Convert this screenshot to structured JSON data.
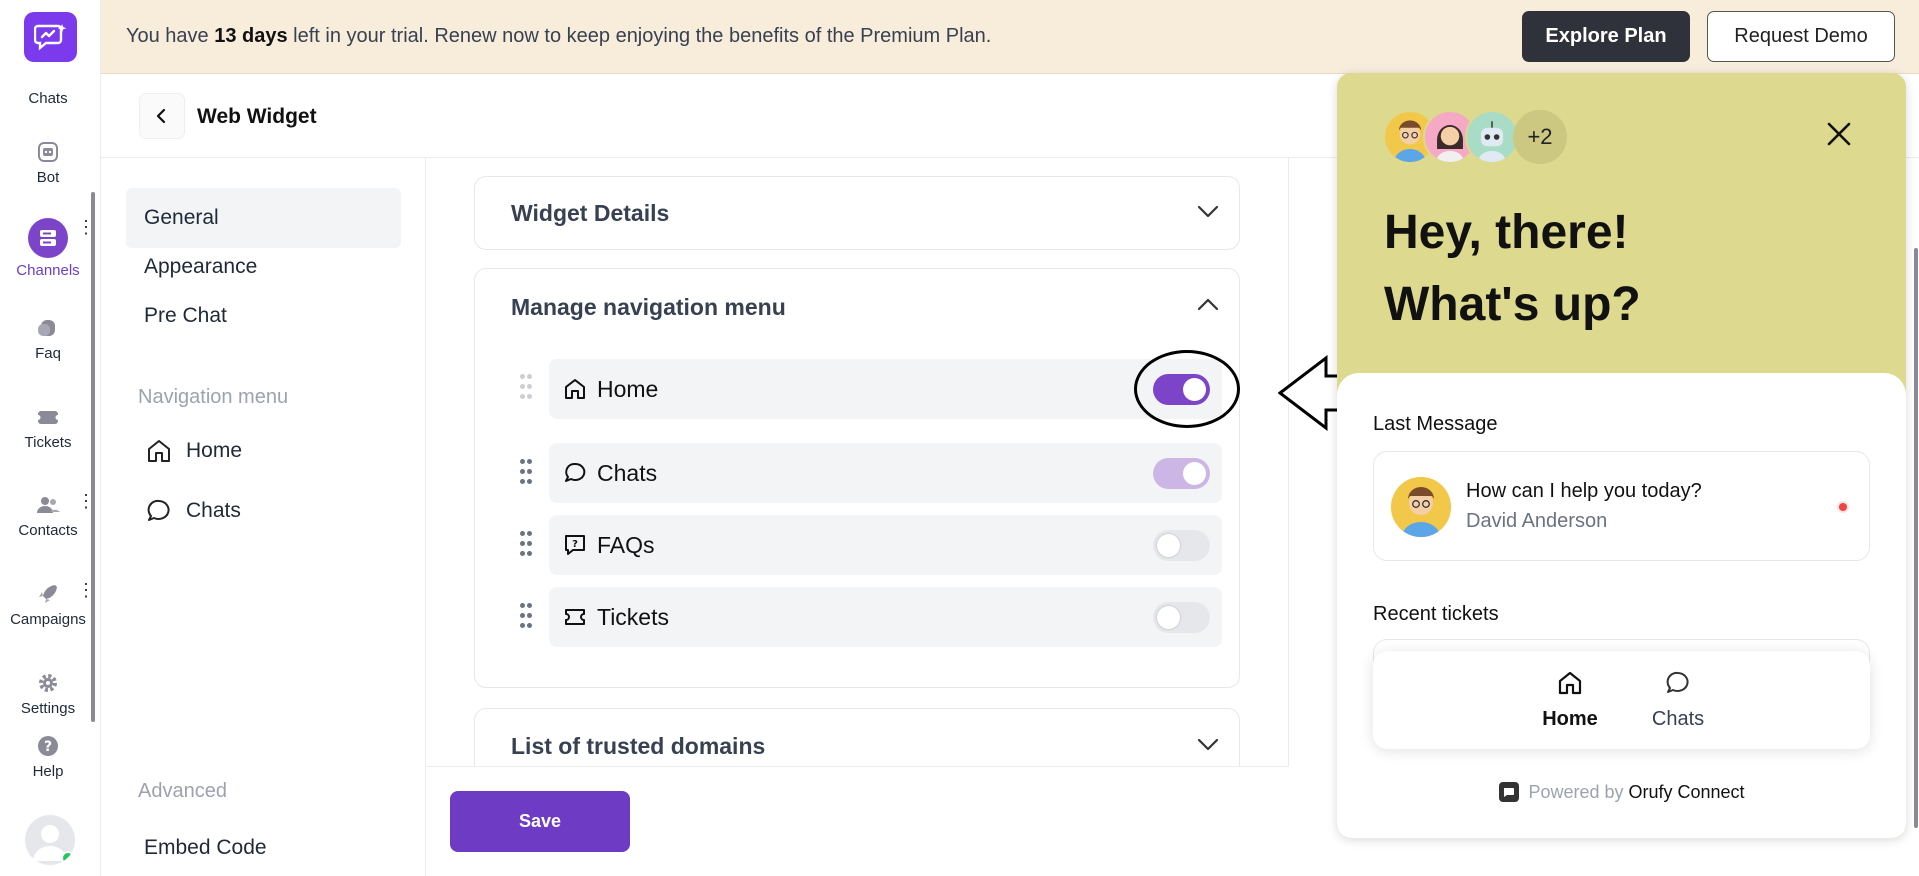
{
  "banner": {
    "text_before": "You have ",
    "days": "13 days",
    "text_after": " left in your trial. Renew now to keep enjoying the benefits of the Premium Plan.",
    "explore_label": "Explore Plan",
    "demo_label": "Request Demo"
  },
  "rail": {
    "items": [
      {
        "label": "Chats",
        "icon": "chat-sparkle-icon"
      },
      {
        "label": "Bot",
        "icon": "bot-icon"
      },
      {
        "label": "Channels",
        "icon": "channels-icon",
        "active": true
      },
      {
        "label": "Faq",
        "icon": "faq-icon"
      },
      {
        "label": "Tickets",
        "icon": "tickets-icon"
      },
      {
        "label": "Contacts",
        "icon": "contacts-icon"
      },
      {
        "label": "Campaigns",
        "icon": "rocket-icon"
      },
      {
        "label": "Settings",
        "icon": "gear-icon"
      },
      {
        "label": "Help",
        "icon": "help-icon"
      }
    ]
  },
  "header": {
    "title": "Web Widget"
  },
  "sidebar": {
    "general": "General",
    "appearance": "Appearance",
    "pre_chat": "Pre Chat",
    "nav_section": "Navigation menu",
    "nav_home": "Home",
    "nav_chats": "Chats",
    "advanced_section": "Advanced",
    "embed_code": "Embed Code"
  },
  "main": {
    "widget_details": "Widget Details",
    "manage_nav": "Manage navigation menu",
    "nav_rows": [
      {
        "label": "Home",
        "icon": "home-icon",
        "state": "on"
      },
      {
        "label": "Chats",
        "icon": "chat-bubble-icon",
        "state": "on-disabled"
      },
      {
        "label": "FAQs",
        "icon": "faq-box-icon",
        "state": "off"
      },
      {
        "label": "Tickets",
        "icon": "ticket-icon",
        "state": "off"
      }
    ],
    "trusted_domains": "List of trusted domains",
    "save_label": "Save"
  },
  "preview": {
    "more_count": "+2",
    "greeting_line1": "Hey, there!",
    "greeting_line2": "What's up?",
    "last_message_title": "Last Message",
    "message_text": "How can I help you today?",
    "message_author": "David Anderson",
    "recent_tickets_title": "Recent tickets",
    "tab_home": "Home",
    "tab_chats": "Chats",
    "powered_by": "Powered by",
    "brand": "Orufy Connect"
  },
  "colors": {
    "accent": "#7c44c9",
    "banner_bg": "#f8ecdb",
    "preview_bg": "#ddd98e",
    "unread_dot": "#ef4444"
  }
}
